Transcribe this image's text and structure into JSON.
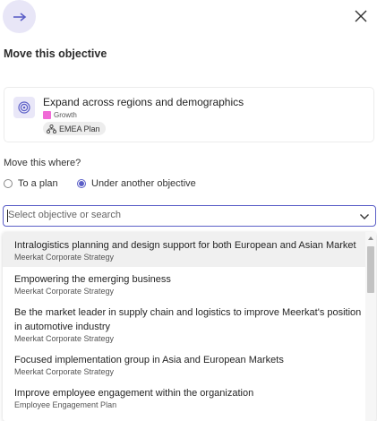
{
  "header": {
    "close_icon": "close-icon",
    "action_icon": "arrow-right-icon"
  },
  "title": "Move this objective",
  "objective": {
    "name": "Expand across regions and demographics",
    "tag": {
      "label": "Growth",
      "color": "#f06ad6"
    },
    "plan_chip": "EMEA Plan"
  },
  "destination": {
    "label": "Move this where?",
    "options": [
      {
        "label": "To a plan",
        "selected": false
      },
      {
        "label": "Under another objective",
        "selected": true
      }
    ]
  },
  "search": {
    "placeholder": "Select objective or search",
    "value": ""
  },
  "results": [
    {
      "title": "Intralogistics planning and design support for both European and Asian Market",
      "plan": "Meerkat Corporate Strategy",
      "highlighted": true
    },
    {
      "title": "Empowering the emerging business",
      "plan": "Meerkat Corporate Strategy",
      "highlighted": false
    },
    {
      "title": "Be the market leader in supply chain and logistics to improve Meerkat's position in automotive industry",
      "plan": "Meerkat Corporate Strategy",
      "highlighted": false
    },
    {
      "title": "Focused implementation group in Asia and European Markets",
      "plan": "Meerkat Corporate Strategy",
      "highlighted": false
    },
    {
      "title": "Improve employee engagement within the organization",
      "plan": "Employee Engagement Plan",
      "highlighted": false
    }
  ],
  "colors": {
    "accent": "#5b5fc7",
    "accent_bg": "#e8e6f7"
  }
}
